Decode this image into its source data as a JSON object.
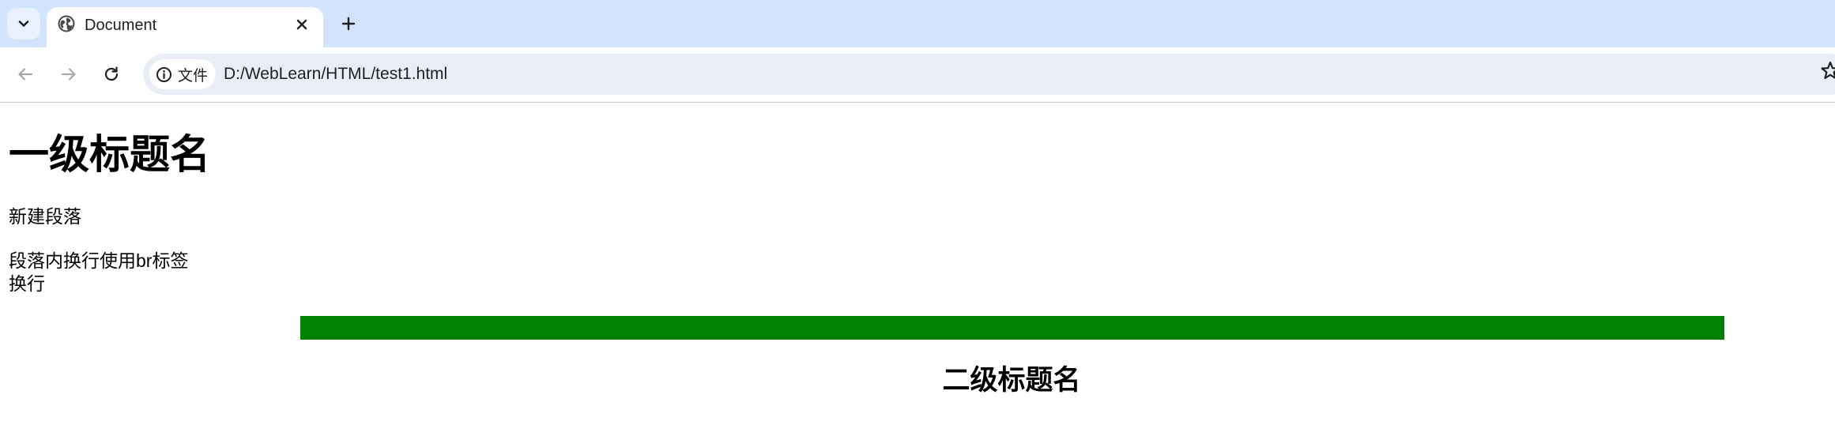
{
  "tab_strip": {
    "search_tabs_icon": "chevron-down-icon",
    "tab": {
      "title": "Document",
      "favicon": "globe-icon",
      "close_icon": "close-icon"
    },
    "new_tab_icon": "plus-icon",
    "background_color": "#d3e3fd"
  },
  "toolbar": {
    "back_icon": "arrow-left-icon",
    "forward_icon": "arrow-right-icon",
    "reload_icon": "reload-icon",
    "site_info": {
      "icon": "info-icon",
      "label": "文件"
    },
    "url": "D:/WebLearn/HTML/test1.html",
    "bookmark_icon": "star-icon",
    "omnibox_color": "#e9eef6"
  },
  "page": {
    "heading1": "一级标题名",
    "paragraph1": "新建段落",
    "paragraph2": {
      "line1": "段落内换行使用br标签",
      "line2": "换行"
    },
    "hr_color": "#008000",
    "heading2": "二级标题名"
  }
}
